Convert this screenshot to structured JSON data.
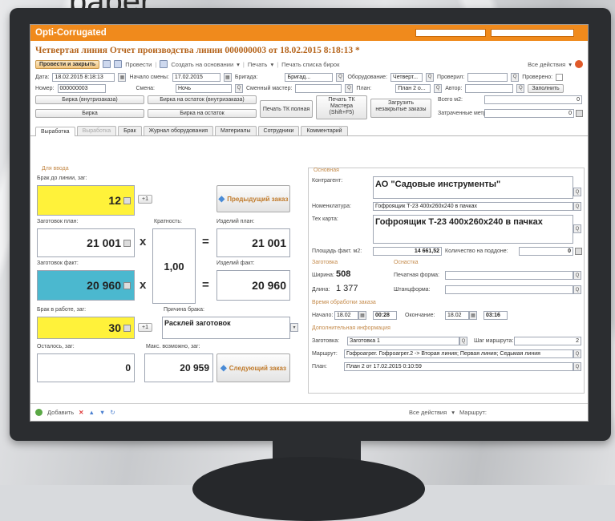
{
  "backdrop_text": "paper",
  "app": {
    "title": "Opti-Corrugated",
    "accent": "#f08a1c"
  },
  "document": {
    "title": "Четвертая линия Отчет производства линии 000000003 от 18.02.2015 8:18:13 *"
  },
  "toolbar": {
    "post_close": "Провести и закрыть",
    "post": "Провести",
    "create_based": "Создать на основании",
    "print": "Печать",
    "print_blanks": "Печать списка бирок",
    "all_actions": "Все действия"
  },
  "header": {
    "date_label": "Дата:",
    "date_value": "18.02.2015 8:18:13",
    "shift_start_label": "Начало смены:",
    "shift_start_value": "17.02.2015",
    "brigade_label": "Бригада:",
    "brigade_value": "Бригад...",
    "equipment_label": "Оборудование:",
    "equipment_value": "Четверт...",
    "checked_label": "Проверил:",
    "checked_value": "",
    "checked_chk_label": "Проверено:",
    "number_label": "Номер:",
    "number_value": "000000003",
    "shift_label": "Смена:",
    "shift_value": "Ночь",
    "master_label": "Сменный мастер:",
    "master_value": "",
    "plan_label": "План:",
    "plan_value": "План 2 о...",
    "author_label": "Автор:",
    "author_value": "",
    "fill_btn": "Заполнить"
  },
  "actions": {
    "tag_internal": "Бирка (внутризаказа)",
    "tag_remainder_internal": "Бирка на остаток (внутризаказа)",
    "print_tk_full": "Печать ТК полная",
    "print_tk_master": "Печать ТК Мастера (Shift+F5)",
    "load_unfinished": "Загрузить незакрытые заказы",
    "tag": "Бирка",
    "tag_remainder": "Бирка на остаток",
    "total_m2_label": "Всего м2:",
    "total_m2_value": "0",
    "spent_m_label": "Затраченные метры:",
    "spent_m_value": "0"
  },
  "tabs": [
    "Выработка",
    "Выработка",
    "Брак",
    "Журнал оборудования",
    "Материалы",
    "Сотрудники",
    "Комментарий"
  ],
  "input": {
    "group": "Для ввода",
    "scrap_before_label": "Брак до линии, заг:",
    "scrap_before_value": "12",
    "plus_one": "+1",
    "prev_order": "Предыдущий заказ",
    "blanks_plan_label": "Заготовок план:",
    "blanks_plan_value": "21 001",
    "multiplicity_label": "Кратность:",
    "multiplicity_value": "1,00",
    "items_plan_label": "Изделий план:",
    "items_plan_value": "21 001",
    "blanks_fact_label": "Заготовок факт:",
    "blanks_fact_value": "20 960",
    "items_fact_label": "Изделий факт:",
    "items_fact_value": "20 960",
    "scrap_work_label": "Брак в работе, заг:",
    "scrap_work_value": "30",
    "reason_label": "Причина брака:",
    "reason_value": "Расклей заготовок",
    "remaining_label": "Осталось, заг:",
    "remaining_value": "0",
    "max_label": "Макс. возможно, заг:",
    "max_value": "20 959",
    "next_order": "Следующий заказ",
    "op_mul": "x",
    "op_eq": "="
  },
  "main": {
    "group": "Основная",
    "contractor_label": "Контрагент:",
    "contractor_value": "АО \"Садовые инструменты\"",
    "nomenclature_label": "Номенклатура:",
    "nomenclature_value": "Гофроящик Т-23 400х260х240 в пачках",
    "techcard_label": "Тех карта:",
    "techcard_value": "Гофроящик Т-23 400х260х240 в пачках",
    "area_label": "Площадь факт. м2:",
    "area_value": "14 661,52",
    "qty_pallet_label": "Количество на поддоне:",
    "qty_pallet_value": "0",
    "blank_group": "Заготовка",
    "finish_group": "Оснастка",
    "width_label": "Ширина:",
    "width_value": "508",
    "print_form_label": "Печатная форма:",
    "length_label": "Длина:",
    "length_value": "1 377",
    "die_form_label": "Штанцформа:",
    "time_group": "Время обработки заказа",
    "start_label": "Начало:",
    "start_date": "18.02",
    "start_time": "00:28",
    "end_label": "Окончание:",
    "end_date": "18.02",
    "end_time": "03:16",
    "extra_group": "Дополнительная информация",
    "blank_label": "Заготовка:",
    "blank_value": "Заготовка 1",
    "route_step_label": "Шаг маршрута:",
    "route_step_value": "2",
    "route_label": "Маршрут:",
    "route_value": "Гофроагрег. Гофроагрег.2 -> Вторая линия; Первая линия; Седьмая линия",
    "plan_label": "План:",
    "plan_value": "План 2 от 17.02.2015 0:10:59"
  },
  "bottom": {
    "add": "Добавить",
    "all_actions": "Все действия",
    "route": "Маршрут:"
  }
}
